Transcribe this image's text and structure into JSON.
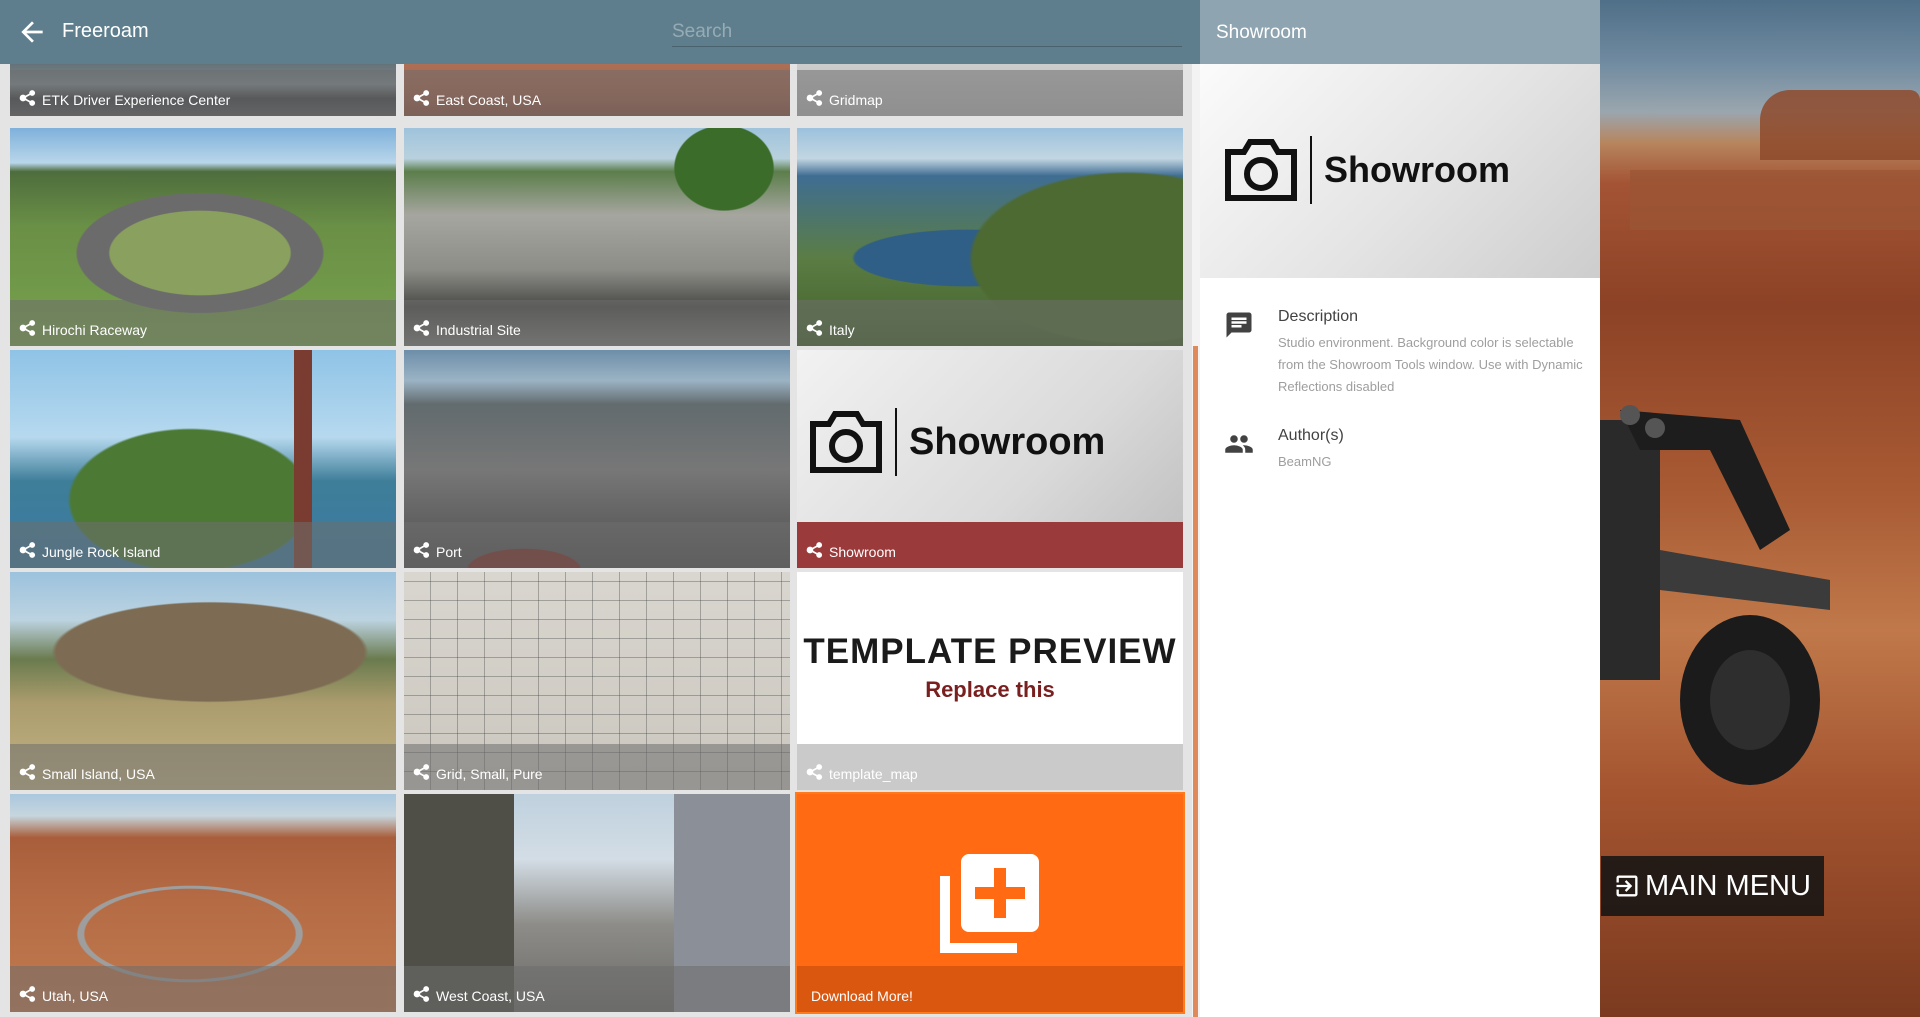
{
  "header": {
    "title": "Freeroam",
    "search_placeholder": "Search"
  },
  "tiles": [
    {
      "label": "ETK Driver Experience Center"
    },
    {
      "label": "East Coast, USA"
    },
    {
      "label": "Gridmap"
    },
    {
      "label": "Hirochi Raceway"
    },
    {
      "label": "Industrial Site"
    },
    {
      "label": "Italy"
    },
    {
      "label": "Jungle Rock Island"
    },
    {
      "label": "Port"
    },
    {
      "label": "Showroom",
      "art_label": "Showroom",
      "selected": true
    },
    {
      "label": "Small Island, USA"
    },
    {
      "label": "Grid, Small, Pure"
    },
    {
      "label": "template_map",
      "art_title": "TEMPLATE PREVIEW",
      "art_subtitle": "Replace this"
    },
    {
      "label": "Utah, USA"
    },
    {
      "label": "West Coast, USA"
    },
    {
      "label": "Download More!"
    }
  ],
  "details": {
    "header_title": "Showroom",
    "preview_label": "Showroom",
    "description_heading": "Description",
    "description": "Studio environment. Background color is selectable from the Showroom Tools window. Use with Dynamic Reflections disabled",
    "authors_heading": "Author(s)",
    "authors": "BeamNG"
  },
  "main_menu": {
    "label": "MAIN MENU"
  },
  "icons": {
    "back": "arrow-left-icon",
    "tile": "map-nodes-icon",
    "showroom_art": "camera-icon",
    "download": "add-library-icon",
    "description": "comment-icon",
    "authors": "people-icon",
    "main_menu": "exit-icon"
  },
  "colors": {
    "header": "#5e7e8d",
    "details_header": "#8ea4b0",
    "selected_caption": "#9a3a3b",
    "download_tile": "#ff6a12",
    "scroll_thumb": "#e0895a"
  }
}
